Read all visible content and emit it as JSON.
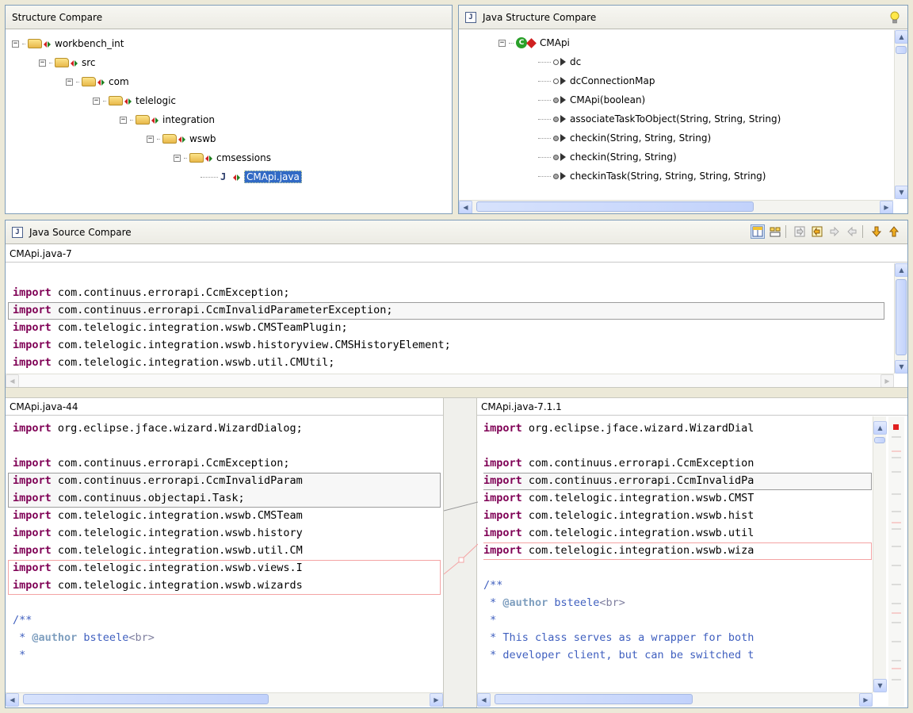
{
  "structure_panel": {
    "title": "Structure Compare",
    "tree": [
      {
        "label": "workbench_int",
        "depth": 0,
        "type": "folder"
      },
      {
        "label": "src",
        "depth": 1,
        "type": "folder"
      },
      {
        "label": "com",
        "depth": 2,
        "type": "folder"
      },
      {
        "label": "telelogic",
        "depth": 3,
        "type": "folder"
      },
      {
        "label": "integration",
        "depth": 4,
        "type": "folder"
      },
      {
        "label": "wswb",
        "depth": 5,
        "type": "folder"
      },
      {
        "label": "cmsessions",
        "depth": 6,
        "type": "folder"
      },
      {
        "label": "CMApi.java",
        "depth": 7,
        "type": "file",
        "selected": true
      }
    ]
  },
  "java_structure": {
    "title": "Java Structure Compare",
    "root": "CMApi",
    "members": [
      {
        "label": "dc",
        "kind": "field"
      },
      {
        "label": "dcConnectionMap",
        "kind": "field"
      },
      {
        "label": "CMApi(boolean)",
        "kind": "method"
      },
      {
        "label": "associateTaskToObject(String, String, String)",
        "kind": "method"
      },
      {
        "label": "checkin(String, String, String)",
        "kind": "method"
      },
      {
        "label": "checkin(String, String)",
        "kind": "method"
      },
      {
        "label": "checkinTask(String, String, String, String)",
        "kind": "method"
      }
    ]
  },
  "source_compare": {
    "title": "Java Source Compare",
    "ancestor": {
      "label": "CMApi.java-7",
      "lines": [
        {
          "kw": "",
          "rest": ""
        },
        {
          "kw": "import",
          "rest": " com.continuus.errorapi.CcmException;"
        },
        {
          "kw": "import",
          "rest": " com.continuus.errorapi.CcmInvalidParameterException;"
        },
        {
          "kw": "import",
          "rest": " com.telelogic.integration.wswb.CMSTeamPlugin;"
        },
        {
          "kw": "import",
          "rest": " com.telelogic.integration.wswb.historyview.CMSHistoryElement;"
        },
        {
          "kw": "import",
          "rest": " com.telelogic.integration.wswb.util.CMUtil;"
        }
      ]
    },
    "left": {
      "label": "CMApi.java-44",
      "lines": [
        {
          "kw": "import",
          "rest": " org.eclipse.jface.wizard.WizardDialog;"
        },
        {
          "kw": "",
          "rest": ""
        },
        {
          "kw": "import",
          "rest": " com.continuus.errorapi.CcmException;"
        },
        {
          "kw": "import",
          "rest": " com.continuus.errorapi.CcmInvalidParam"
        },
        {
          "kw": "import",
          "rest": " com.continuus.objectapi.Task;"
        },
        {
          "kw": "import",
          "rest": " com.telelogic.integration.wswb.CMSTeam"
        },
        {
          "kw": "import",
          "rest": " com.telelogic.integration.wswb.history"
        },
        {
          "kw": "import",
          "rest": " com.telelogic.integration.wswb.util.CM"
        },
        {
          "kw": "import",
          "rest": " com.telelogic.integration.wswb.views.I"
        },
        {
          "kw": "import",
          "rest": " com.telelogic.integration.wswb.wizards"
        },
        {
          "kw": "",
          "rest": ""
        },
        {
          "kw": "",
          "rest": "/**",
          "cls": "doc"
        },
        {
          "kw": "",
          "rest": " * ",
          "cls": "doc",
          "tag": "@author",
          "after": " bsteele",
          "br": "<br>"
        },
        {
          "kw": "",
          "rest": " *",
          "cls": "doc"
        }
      ]
    },
    "right": {
      "label": "CMApi.java-7.1.1",
      "lines": [
        {
          "kw": "import",
          "rest": " org.eclipse.jface.wizard.WizardDial"
        },
        {
          "kw": "",
          "rest": ""
        },
        {
          "kw": "import",
          "rest": " com.continuus.errorapi.CcmException"
        },
        {
          "kw": "import",
          "rest": " com.continuus.errorapi.CcmInvalidPa"
        },
        {
          "kw": "import",
          "rest": " com.telelogic.integration.wswb.CMST"
        },
        {
          "kw": "import",
          "rest": " com.telelogic.integration.wswb.hist"
        },
        {
          "kw": "import",
          "rest": " com.telelogic.integration.wswb.util"
        },
        {
          "kw": "import",
          "rest": " com.telelogic.integration.wswb.wiza"
        },
        {
          "kw": "",
          "rest": ""
        },
        {
          "kw": "",
          "rest": "/**",
          "cls": "doc"
        },
        {
          "kw": "",
          "rest": " * ",
          "cls": "doc",
          "tag": "@author",
          "after": " bsteele",
          "br": "<br>"
        },
        {
          "kw": "",
          "rest": " *",
          "cls": "doc"
        },
        {
          "kw": "",
          "rest": " * This class serves as a wrapper for both",
          "cls": "doc"
        },
        {
          "kw": "",
          "rest": " * developer client, but can be switched t",
          "cls": "doc"
        }
      ]
    }
  },
  "icons": {
    "bulb": "lightbulb-icon",
    "toolbar": [
      "ancestor-pane-icon",
      "ignore-whitespace-icon",
      "copy-all-left-to-right-icon",
      "copy-all-right-to-left-icon",
      "copy-current-left-to-right-icon",
      "copy-current-right-to-left-icon",
      "next-difference-icon",
      "previous-difference-icon"
    ]
  }
}
